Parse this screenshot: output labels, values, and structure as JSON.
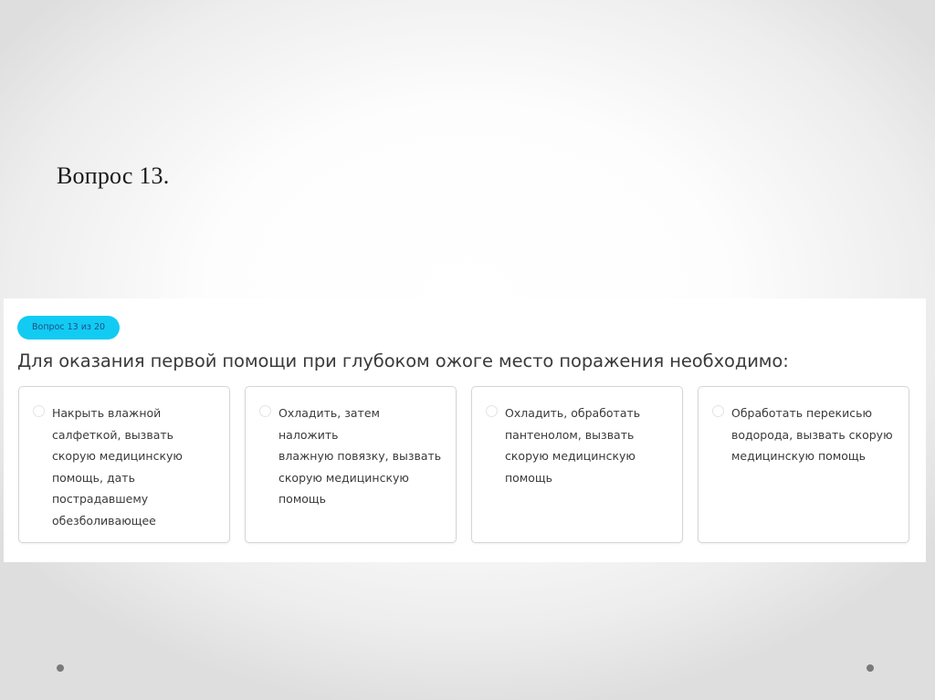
{
  "slide": {
    "title": "Вопрос 13."
  },
  "quiz": {
    "badge": "Вопрос 13 из 20",
    "question": "Для оказания первой помощи при глубоком ожоге место поражения необходимо:",
    "accent_color": "#12cbf3",
    "options": [
      {
        "lines": [
          "Накрыть влажной",
          "салфеткой, вызвать",
          "скорую медицинскую",
          "помощь, дать",
          "пострадавшему",
          "обезболивающее"
        ]
      },
      {
        "lines": [
          "Охладить, затем наложить",
          "влажную повязку, вызвать",
          "скорую медицинскую",
          "помощь"
        ]
      },
      {
        "lines": [
          "Охладить, обработать",
          "пантенолом, вызвать",
          "скорую медицинскую",
          "помощь"
        ]
      },
      {
        "lines": [
          "Обработать перекисью",
          "водорода, вызвать скорую",
          "медицинскую помощь"
        ]
      }
    ]
  }
}
